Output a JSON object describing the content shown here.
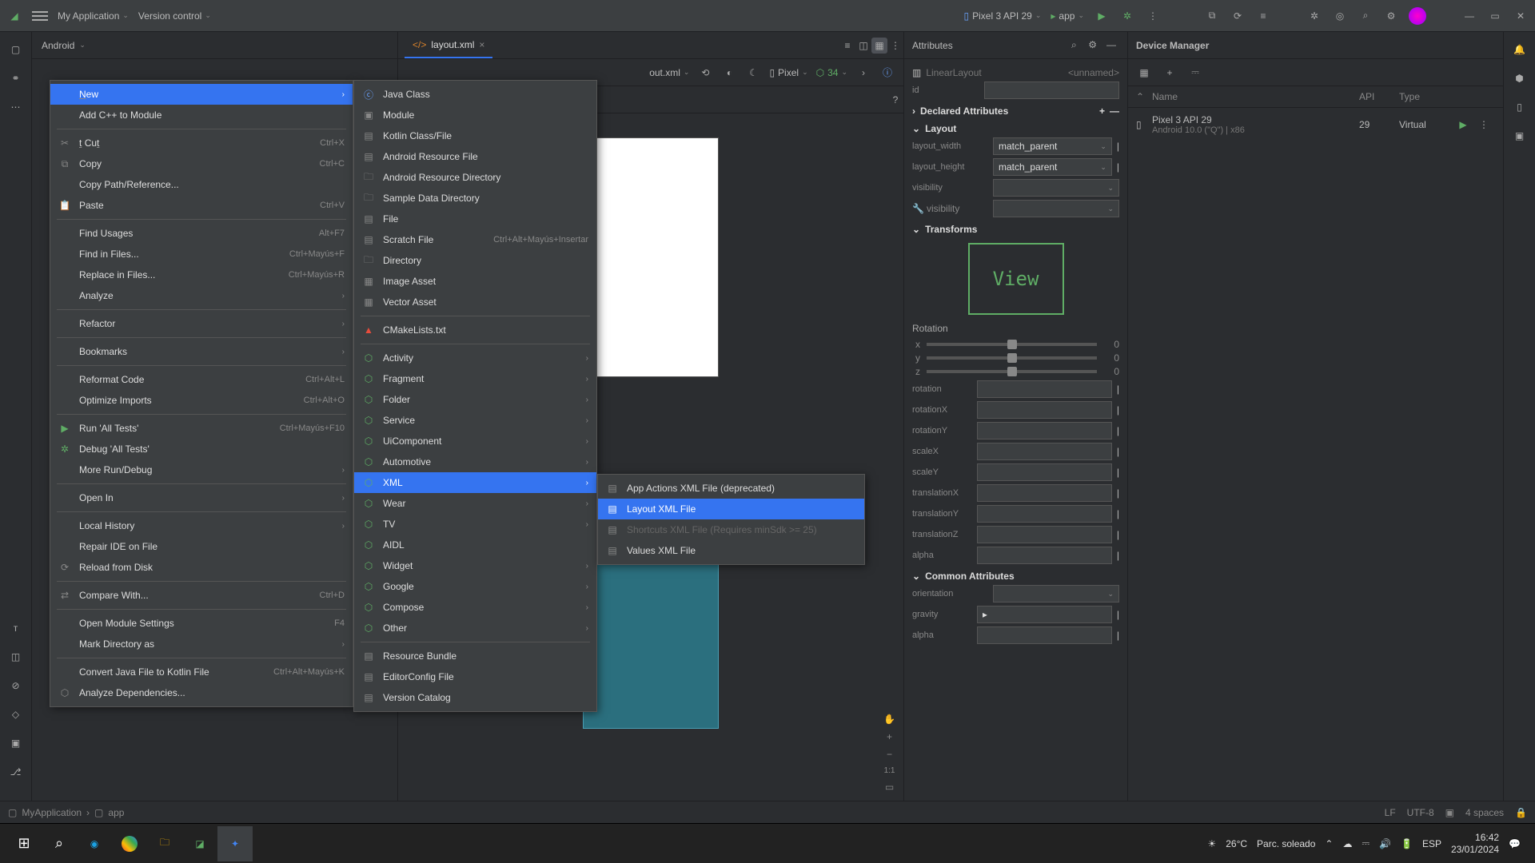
{
  "titlebar": {
    "project": "My Application",
    "vcs": "Version control",
    "device": "Pixel 3 API 29",
    "config": "app"
  },
  "sidebar": {
    "mode": "Android"
  },
  "tab": {
    "name": "layout.xml"
  },
  "editor_top": {
    "file_label": "out.xml",
    "device_label": "Pixel",
    "api_label": "34"
  },
  "attributes": {
    "title": "Attributes",
    "root_type": "LinearLayout",
    "root_name": "<unnamed>",
    "id_label": "id",
    "declared": "Declared Attributes",
    "layout_section": "Layout",
    "layout_width_label": "layout_width",
    "layout_width": "match_parent",
    "layout_height_label": "layout_height",
    "layout_height": "match_parent",
    "visibility_label": "visibility",
    "tools_visibility_label": "visibility",
    "transforms": "Transforms",
    "view_text": "View",
    "rotation_title": "Rotation",
    "axis_x": "x",
    "axis_y": "y",
    "axis_z": "z",
    "slider_val": "0",
    "rotation": "rotation",
    "rotationX": "rotationX",
    "rotationY": "rotationY",
    "scaleX": "scaleX",
    "scaleY": "scaleY",
    "translationX": "translationX",
    "translationY": "translationY",
    "translationZ": "translationZ",
    "alpha": "alpha",
    "common": "Common Attributes",
    "orientation": "orientation",
    "gravity": "gravity",
    "alpha2": "alpha"
  },
  "devmgr": {
    "title": "Device Manager",
    "col_name": "Name",
    "col_api": "API",
    "col_type": "Type",
    "row_name": "Pixel 3 API 29",
    "row_sub": "Android 10.0 (\"Q\") | x86",
    "row_api": "29",
    "row_type": "Virtual"
  },
  "status": {
    "bc1": "MyApplication",
    "bc2": "app",
    "lf": "LF",
    "enc": "UTF-8",
    "spaces": "4 spaces"
  },
  "taskbar": {
    "weather_temp": "26°C",
    "weather_text": "Parc. soleado",
    "lang": "ESP",
    "time": "16:42",
    "date": "23/01/2024"
  },
  "menu1": {
    "new": "New",
    "add_cpp": "Add C++ to Module",
    "cut": "Cut",
    "cut_sc": "Ctrl+X",
    "copy": "Copy",
    "copy_sc": "Ctrl+C",
    "copy_path": "Copy Path/Reference...",
    "paste": "Paste",
    "paste_sc": "Ctrl+V",
    "find_usages": "Find Usages",
    "find_usages_sc": "Alt+F7",
    "find_in_files": "Find in Files...",
    "find_in_files_sc": "Ctrl+Mayús+F",
    "replace_in_files": "Replace in Files...",
    "replace_in_files_sc": "Ctrl+Mayús+R",
    "analyze": "Analyze",
    "refactor": "Refactor",
    "bookmarks": "Bookmarks",
    "reformat": "Reformat Code",
    "reformat_sc": "Ctrl+Alt+L",
    "optimize": "Optimize Imports",
    "optimize_sc": "Ctrl+Alt+O",
    "run_all": "Run 'All Tests'",
    "run_all_sc": "Ctrl+Mayús+F10",
    "debug_all": "Debug 'All Tests'",
    "more_run": "More Run/Debug",
    "open_in": "Open In",
    "local_history": "Local History",
    "repair_ide": "Repair IDE on File",
    "reload": "Reload from Disk",
    "compare": "Compare With...",
    "compare_sc": "Ctrl+D",
    "open_module": "Open Module Settings",
    "open_module_sc": "F4",
    "mark_dir": "Mark Directory as",
    "convert": "Convert Java File to Kotlin File",
    "convert_sc": "Ctrl+Alt+Mayús+K",
    "analyze_deps": "Analyze Dependencies..."
  },
  "menu2": {
    "java_class": "Java Class",
    "module": "Module",
    "kotlin": "Kotlin Class/File",
    "android_res_file": "Android Resource File",
    "android_res_dir": "Android Resource Directory",
    "sample_data": "Sample Data Directory",
    "file": "File",
    "scratch": "Scratch File",
    "scratch_sc": "Ctrl+Alt+Mayús+Insertar",
    "directory": "Directory",
    "image_asset": "Image Asset",
    "vector_asset": "Vector Asset",
    "cmake": "CMakeLists.txt",
    "activity": "Activity",
    "fragment": "Fragment",
    "folder": "Folder",
    "service": "Service",
    "uicomponent": "UiComponent",
    "automotive": "Automotive",
    "xml": "XML",
    "wear": "Wear",
    "tv": "TV",
    "aidl": "AIDL",
    "widget": "Widget",
    "google": "Google",
    "compose": "Compose",
    "other": "Other",
    "resource_bundle": "Resource Bundle",
    "editorconfig": "EditorConfig File",
    "version_catalog": "Version Catalog"
  },
  "menu3": {
    "app_actions": "App Actions XML File (deprecated)",
    "layout_xml": "Layout XML File",
    "shortcuts": "Shortcuts XML File (Requires minSdk >= 25)",
    "values": "Values XML File"
  }
}
